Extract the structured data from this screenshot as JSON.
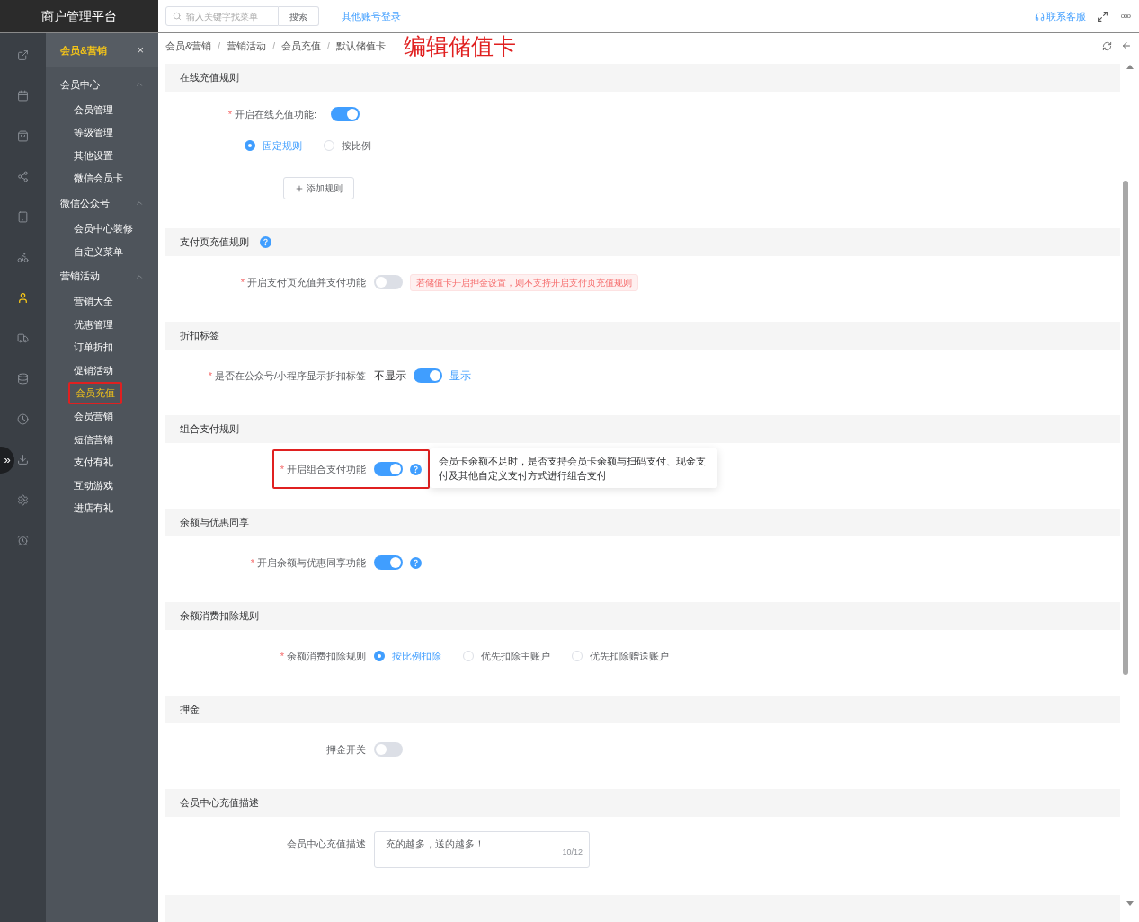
{
  "brand": "商户管理平台",
  "topbar": {
    "search": {
      "placeholder": "输入关键字找菜单",
      "button": "搜索"
    },
    "link": "其他账号登录",
    "support": "联系客服",
    "more": "ooo"
  },
  "rail": [
    {
      "selected": false
    },
    {
      "selected": false
    },
    {
      "selected": false
    },
    {
      "selected": false
    },
    {
      "selected": false
    },
    {
      "selected": false
    },
    {
      "selected": true
    },
    {
      "selected": false
    },
    {
      "selected": false
    },
    {
      "selected": false
    },
    {
      "selected": false
    },
    {
      "selected": false
    },
    {
      "selected": false
    }
  ],
  "collapse_toggle": "»",
  "sidebar": {
    "title": "会员&营销",
    "close": "×",
    "groups": [
      {
        "label": "会员中心",
        "expanded": true,
        "children": [
          {
            "label": "会员管理",
            "selected": false,
            "highlighted": false
          },
          {
            "label": "等级管理",
            "selected": false,
            "highlighted": false
          },
          {
            "label": "其他设置",
            "selected": false,
            "highlighted": false
          },
          {
            "label": "微信会员卡",
            "selected": false,
            "highlighted": false
          }
        ]
      },
      {
        "label": "微信公众号",
        "expanded": true,
        "children": [
          {
            "label": "会员中心装修",
            "selected": false,
            "highlighted": false
          },
          {
            "label": "自定义菜单",
            "selected": false,
            "highlighted": false
          }
        ]
      },
      {
        "label": "营销活动",
        "expanded": true,
        "children": [
          {
            "label": "营销大全",
            "selected": false,
            "highlighted": false
          },
          {
            "label": "优惠管理",
            "selected": false,
            "highlighted": false
          },
          {
            "label": "订单折扣",
            "selected": false,
            "highlighted": false
          },
          {
            "label": "促销活动",
            "selected": false,
            "highlighted": false
          },
          {
            "label": "会员充值",
            "selected": true,
            "highlighted": true
          },
          {
            "label": "会员营销",
            "selected": false,
            "highlighted": false
          },
          {
            "label": "短信营销",
            "selected": false,
            "highlighted": false
          },
          {
            "label": "支付有礼",
            "selected": false,
            "highlighted": false
          },
          {
            "label": "互动游戏",
            "selected": false,
            "highlighted": false
          },
          {
            "label": "进店有礼",
            "selected": false,
            "highlighted": false
          }
        ]
      }
    ]
  },
  "breadcrumb": {
    "items": [
      "会员&营销",
      "营销活动",
      "会员充值",
      "默认储值卡"
    ],
    "separator": "/",
    "annotation": "编辑储值卡"
  },
  "sections": [
    {
      "title": "在线充值规则",
      "rows": [
        {
          "kind": "switch",
          "mark": "*",
          "label": "开启在线充值功能:",
          "on": true
        },
        {
          "kind": "radio",
          "options": [
            {
              "label": "固定规则",
              "selected": true
            },
            {
              "label": "按比例",
              "selected": false
            }
          ]
        },
        {
          "kind": "button",
          "label": "添加规则"
        }
      ]
    },
    {
      "title": "支付页充值规则",
      "help": true,
      "rows": [
        {
          "kind": "switch",
          "mark": "*",
          "label": "开启支付页充值并支付功能",
          "on": false,
          "tag": "若储值卡开启押金设置，则不支持开启支付页充值规则"
        }
      ]
    },
    {
      "title": "折扣标签",
      "rows": [
        {
          "kind": "switch",
          "mark": "*",
          "label": "是否在公众号/小程序显示折扣标签",
          "on": true,
          "off_label": "不显示",
          "on_label": "显示"
        }
      ]
    },
    {
      "title": "组合支付规则",
      "rows": [
        {
          "kind": "switch",
          "mark": "*",
          "label": "开启组合支付功能",
          "on": true,
          "help": true,
          "highlighted": true,
          "tooltip": "会员卡余额不足时，是否支持会员卡余额与扫码支付、现金支付及其他自定义支付方式进行组合支付"
        }
      ]
    },
    {
      "title": "余额与优惠同享",
      "rows": [
        {
          "kind": "switch",
          "mark": "*",
          "label": "开启余额与优惠同享功能",
          "on": true,
          "help": true
        }
      ]
    },
    {
      "title": "余额消费扣除规则",
      "rows": [
        {
          "kind": "radio",
          "mark": "*",
          "label": "余额消费扣除规则",
          "options": [
            {
              "label": "按比例扣除",
              "selected": true
            },
            {
              "label": "优先扣除主账户",
              "selected": false
            },
            {
              "label": "优先扣除赠送账户",
              "selected": false
            }
          ]
        }
      ]
    },
    {
      "title": "押金",
      "rows": [
        {
          "kind": "switch",
          "label": "押金开关",
          "on": false
        }
      ]
    },
    {
      "title": "会员中心充值描述",
      "rows": [
        {
          "kind": "textarea",
          "label": "会员中心充值描述",
          "value": "充的越多，送的越多！",
          "counter": "10/12"
        }
      ]
    }
  ]
}
